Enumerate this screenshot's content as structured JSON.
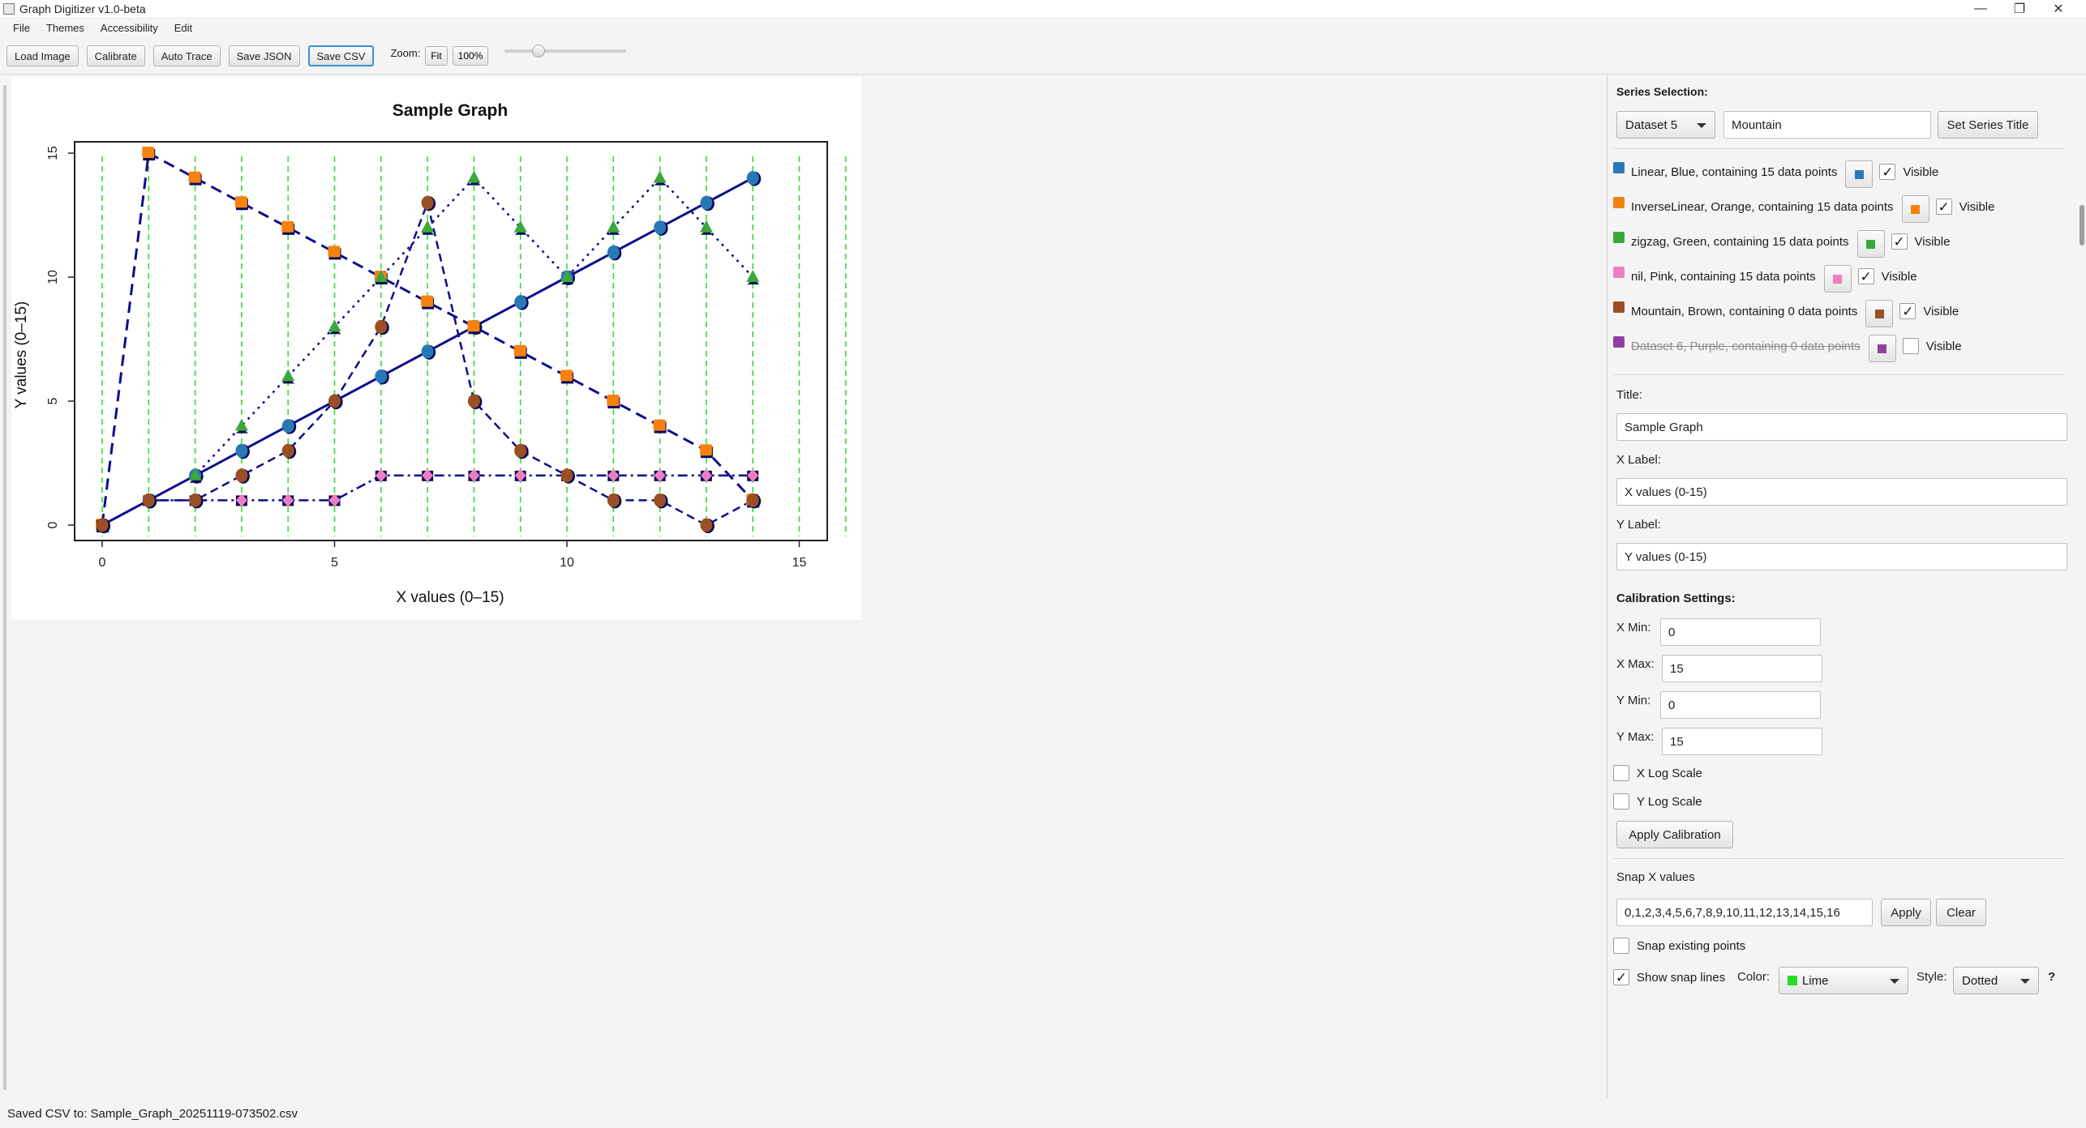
{
  "window": {
    "title": "Graph Digitizer v1.0-beta",
    "minimize": "—",
    "restore": "❐",
    "close": "✕"
  },
  "menu": [
    "File",
    "Themes",
    "Accessibility",
    "Edit"
  ],
  "toolbar": {
    "buttons": [
      "Load Image",
      "Calibrate",
      "Auto Trace",
      "Save JSON",
      "Save CSV"
    ],
    "zoom_label": "Zoom:",
    "zoom_fit": "Fit",
    "zoom_100": "100%",
    "zoom_slider_level": 0.25
  },
  "chart_data": {
    "type": "scatter",
    "title": "Sample Graph",
    "xlabel": "X values (0–15)",
    "ylabel": "Y values (0–15)",
    "xlim": [
      0,
      15
    ],
    "ylim": [
      0,
      15
    ],
    "xticks": [
      "0",
      "5",
      "10",
      "15"
    ],
    "yticks": [
      "0",
      "5",
      "10",
      "15"
    ],
    "snap_x": [
      0,
      1,
      2,
      3,
      4,
      5,
      6,
      7,
      8,
      9,
      10,
      11,
      12,
      13,
      14,
      15,
      16
    ],
    "snap_color": "#33dd33",
    "series": [
      {
        "name": "Linear",
        "color": "#2878b8",
        "marker": "circle",
        "x": [
          0,
          1,
          2,
          3,
          4,
          5,
          6,
          7,
          8,
          9,
          10,
          11,
          12,
          13,
          14
        ],
        "y": [
          0,
          1,
          2,
          3,
          4,
          5,
          6,
          7,
          8,
          9,
          10,
          11,
          12,
          13,
          14
        ]
      },
      {
        "name": "InverseLinear",
        "color": "#f5820f",
        "marker": "square",
        "x": [
          0,
          1,
          2,
          3,
          4,
          5,
          6,
          7,
          8,
          9,
          10,
          11,
          12,
          13,
          14
        ],
        "y": [
          0,
          15,
          14,
          13,
          12,
          11,
          10,
          9,
          8,
          7,
          6,
          5,
          4,
          3,
          1
        ]
      },
      {
        "name": "zigzag",
        "color": "#3aa83a",
        "marker": "triangle",
        "x": [
          0,
          2,
          3,
          4,
          5,
          6,
          7,
          8,
          9,
          10,
          11,
          12,
          13,
          14
        ],
        "y": [
          0,
          2,
          4,
          6,
          8,
          10,
          12,
          14,
          12,
          10,
          12,
          14,
          12,
          10
        ]
      },
      {
        "name": "nil",
        "color": "#ef7ec0",
        "marker": "diamond",
        "x": [
          0,
          1,
          2,
          3,
          4,
          5,
          6,
          7,
          8,
          9,
          10,
          11,
          12,
          13,
          14
        ],
        "y": [
          0,
          1,
          1,
          1,
          1,
          1,
          2,
          2,
          2,
          2,
          2,
          2,
          2,
          2,
          2
        ]
      },
      {
        "name": "Mountain",
        "color": "#9a4f24",
        "marker": "circle",
        "x": [
          0,
          1,
          2,
          3,
          4,
          5,
          6,
          7,
          8,
          9,
          10,
          11,
          12,
          13,
          14
        ],
        "y": [
          0,
          1,
          1,
          2,
          3,
          5,
          8,
          13,
          5,
          3,
          2,
          1,
          1,
          0,
          1
        ]
      }
    ]
  },
  "panel": {
    "series_selection_title": "Series Selection:",
    "dataset_combo": "Dataset 5",
    "series_title_value": "Mountain",
    "set_series_title": "Set Series Title",
    "series": [
      {
        "label": "Linear, Blue, containing 15 data points",
        "color": "#2878b8",
        "visible": true,
        "visible_label": "Visible",
        "check": "✓"
      },
      {
        "label": "InverseLinear, Orange, containing 15 data points",
        "color": "#f5820f",
        "visible": true,
        "visible_label": "Visible",
        "check": "✓"
      },
      {
        "label": "zigzag, Green, containing 15 data points",
        "color": "#3aa83a",
        "visible": true,
        "visible_label": "Visible",
        "check": "✓"
      },
      {
        "label": "nil, Pink, containing 15 data points",
        "color": "#ef7ec0",
        "visible": true,
        "visible_label": "Visible",
        "check": "✓"
      },
      {
        "label": "Mountain, Brown, containing 0 data points",
        "color": "#9a4f24",
        "visible": true,
        "visible_label": "Visible",
        "check": "✓"
      },
      {
        "label": "Dataset 6, Purple, containing 0 data points",
        "color": "#9040a0",
        "visible": false,
        "visible_label": "Visible",
        "check": ""
      }
    ],
    "title_label": "Title:",
    "title_value": "Sample Graph",
    "xlabel_label": "X Label:",
    "xlabel_value": "X values (0-15)",
    "ylabel_label": "Y Label:",
    "ylabel_value": "Y values (0-15)",
    "calib_title": "Calibration Settings:",
    "xmin_label": "X Min:",
    "xmin_value": "0",
    "xmax_label": "X Max:",
    "xmax_value": "15",
    "ymin_label": "Y Min:",
    "ymin_value": "0",
    "ymax_label": "Y Max:",
    "ymax_value": "15",
    "xlog_label": "X Log Scale",
    "ylog_label": "Y Log Scale",
    "apply_calibration": "Apply Calibration",
    "snap_title": "Snap X values",
    "snap_values": "0,1,2,3,4,5,6,7,8,9,10,11,12,13,14,15,16",
    "apply": "Apply",
    "clear": "Clear",
    "snap_existing": "Snap existing points",
    "show_snap_lines": "Show snap lines",
    "show_snap_check": "✓",
    "color_label": "Color:",
    "color_value": "Lime",
    "color_swatch": "#22dd22",
    "style_label": "Style:",
    "style_value": "Dotted",
    "help": "?"
  },
  "status": "Saved CSV to: Sample_Graph_20251119-073502.csv"
}
